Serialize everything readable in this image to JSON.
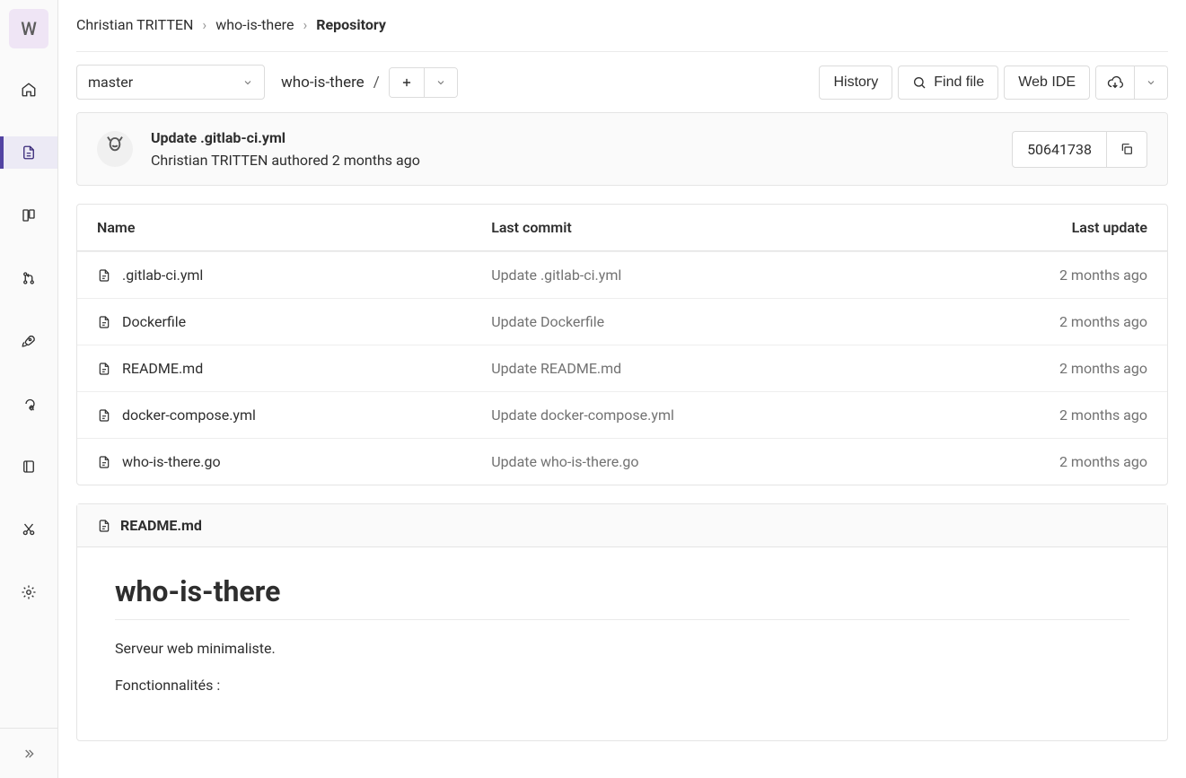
{
  "sidebar": {
    "project_initial": "W"
  },
  "breadcrumbs": {
    "owner": "Christian TRITTEN",
    "project": "who-is-there",
    "current": "Repository"
  },
  "toolbar": {
    "branch": "master",
    "path_root": "who-is-there",
    "history_label": "History",
    "find_file_label": "Find file",
    "web_ide_label": "Web IDE"
  },
  "commit": {
    "title": "Update .gitlab-ci.yml",
    "author": "Christian TRITTEN",
    "authored_time": "2 months ago",
    "sha_short": "50641738"
  },
  "files": {
    "headers": {
      "name": "Name",
      "last_commit": "Last commit",
      "last_update": "Last update"
    },
    "rows": [
      {
        "name": ".gitlab-ci.yml",
        "commit": "Update .gitlab-ci.yml",
        "updated": "2 months ago"
      },
      {
        "name": "Dockerfile",
        "commit": "Update Dockerfile",
        "updated": "2 months ago"
      },
      {
        "name": "README.md",
        "commit": "Update README.md",
        "updated": "2 months ago"
      },
      {
        "name": "docker-compose.yml",
        "commit": "Update docker-compose.yml",
        "updated": "2 months ago"
      },
      {
        "name": "who-is-there.go",
        "commit": "Update who-is-there.go",
        "updated": "2 months ago"
      }
    ]
  },
  "readme": {
    "filename": "README.md",
    "heading": "who-is-there",
    "p1": "Serveur web minimaliste.",
    "p2": "Fonctionnalités :"
  }
}
